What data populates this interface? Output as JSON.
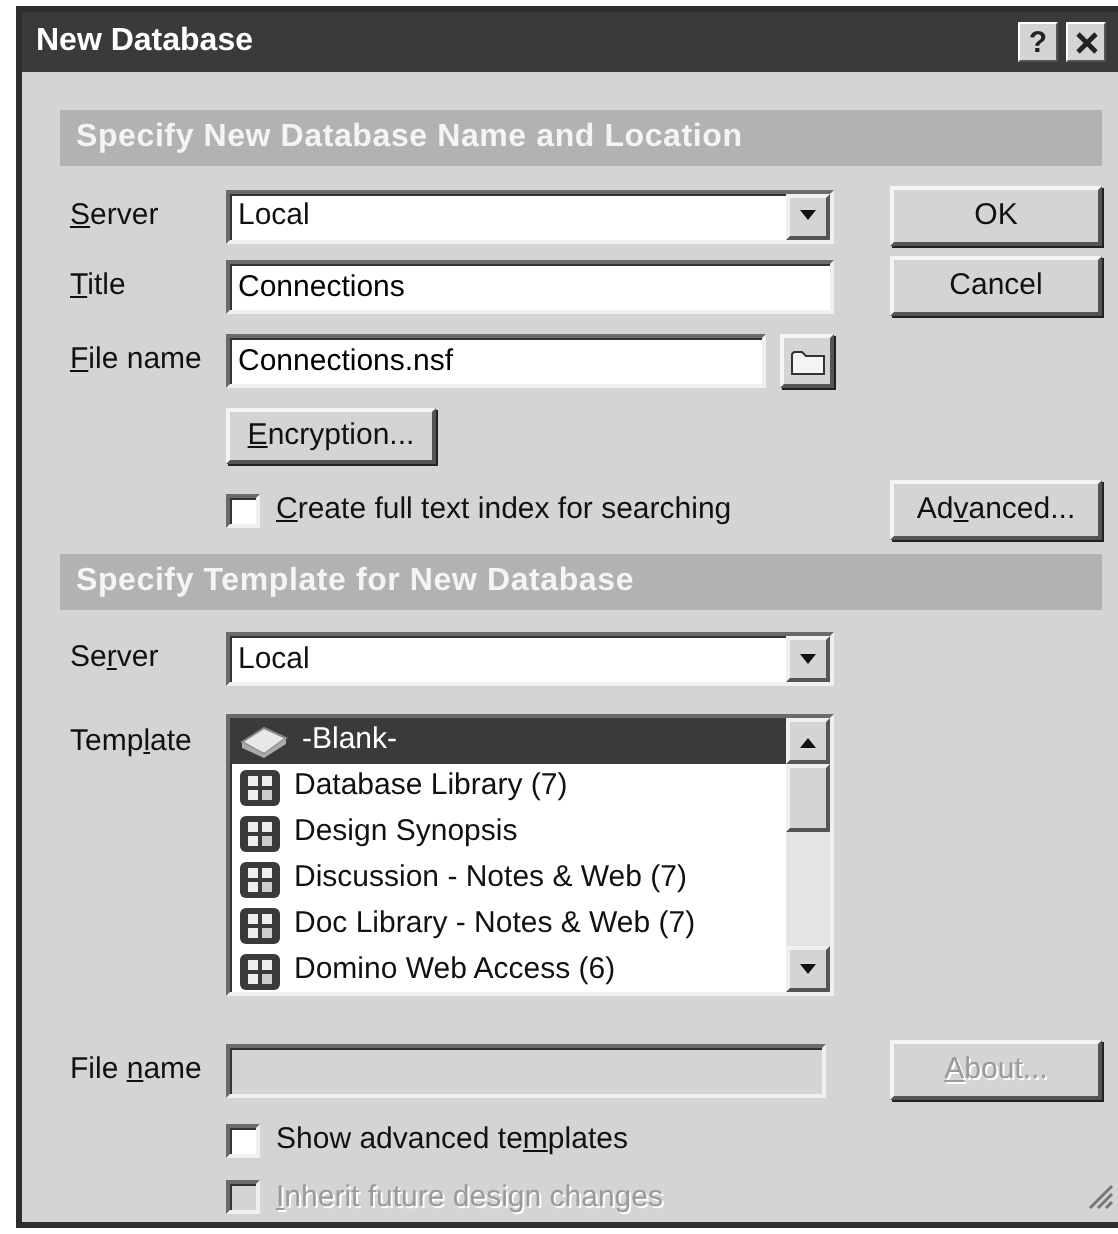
{
  "window": {
    "title": "New Database",
    "help": "?"
  },
  "location": {
    "heading": "Specify New Database Name and Location",
    "server": {
      "label": {
        "key": "S",
        "post": "erver"
      },
      "value": "Local"
    },
    "title": {
      "label": {
        "key": "T",
        "post": "itle"
      },
      "value": "Connections"
    },
    "file_name": {
      "label": {
        "key": "F",
        "post": "ile name"
      },
      "value": "Connections.nsf"
    },
    "encryption_button": {
      "label": {
        "key": "E",
        "post": "ncryption..."
      }
    },
    "full_text_index": {
      "label": {
        "key": "C",
        "post": "reate full text index for searching"
      },
      "checked": false
    }
  },
  "buttons": [
    {
      "label": {
        "pre": "OK"
      }
    },
    {
      "label": {
        "pre": "Cancel"
      }
    }
  ],
  "advanced_button": {
    "label": {
      "pre": "Ad",
      "key": "v",
      "post": "anced..."
    }
  },
  "template": {
    "heading": "Specify Template for New Database",
    "server": {
      "label": {
        "pre": "Se",
        "key": "r",
        "post": "ver"
      },
      "value": "Local"
    },
    "list": {
      "label": {
        "pre": "Temp",
        "key": "l",
        "post": "ate"
      },
      "items": [
        {
          "name": "-Blank-",
          "kind": "blank",
          "selected": true
        },
        {
          "name": "Database Library (7)",
          "kind": "template",
          "selected": false
        },
        {
          "name": "Design Synopsis",
          "kind": "template",
          "selected": false
        },
        {
          "name": "Discussion - Notes & Web (7)",
          "kind": "template",
          "selected": false
        },
        {
          "name": "Doc Library - Notes & Web (7)",
          "kind": "template",
          "selected": false
        },
        {
          "name": "Domino Web Access (6)",
          "kind": "template",
          "selected": false
        }
      ]
    },
    "file_name": {
      "label": {
        "pre": "File ",
        "key": "n",
        "post": "ame"
      },
      "disabled": true
    },
    "about_button": {
      "label": {
        "key": "A",
        "post": "bout..."
      },
      "disabled": true
    },
    "show_advanced": {
      "label": {
        "pre": "Show advanced te",
        "key": "m",
        "post": "plates"
      },
      "checked": false,
      "disabled": false
    },
    "inherit": {
      "label": {
        "key": "I",
        "post": "nherit future design changes"
      },
      "checked": false,
      "disabled": true
    }
  }
}
